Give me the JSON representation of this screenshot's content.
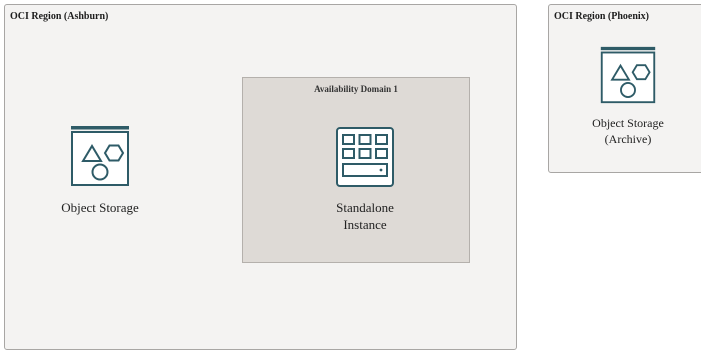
{
  "colors": {
    "icon_stroke": "#2e5b67",
    "region_fill": "#f4f3f2",
    "availability_domain_fill": "#dedad6"
  },
  "regions": [
    {
      "label": "OCI Region (Ashburn)",
      "availability_domains": [
        {
          "label": "Availability Domain 1",
          "nodes": [
            {
              "icon": "compute-instance-icon",
              "label_lines": [
                "Standalone",
                "Instance"
              ]
            }
          ]
        }
      ],
      "nodes": [
        {
          "icon": "object-storage-icon",
          "label_lines": [
            "Object Storage"
          ]
        }
      ]
    },
    {
      "label": "OCI Region (Phoenix)",
      "nodes": [
        {
          "icon": "object-storage-icon",
          "label_lines": [
            "Object Storage",
            "(Archive)"
          ]
        }
      ]
    }
  ]
}
